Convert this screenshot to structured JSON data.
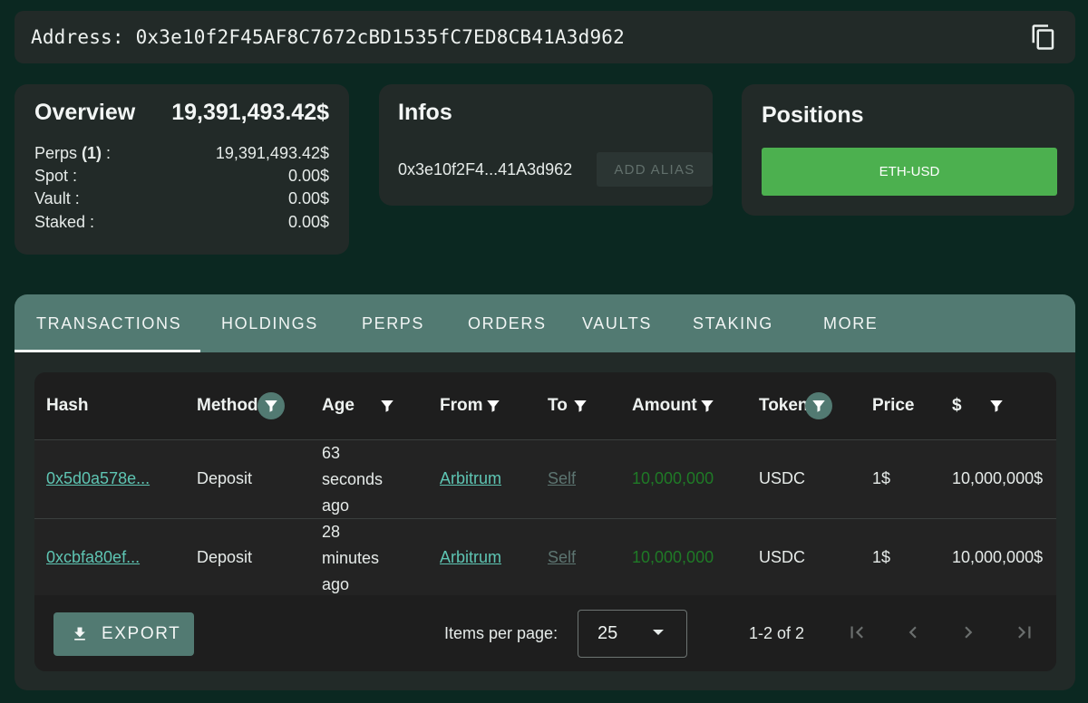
{
  "address_bar": {
    "label": "Address: 0x3e10f2F45AF8C7672cBD1535fC7ED8CB41A3d962",
    "copy_icon": "copy-icon"
  },
  "overview": {
    "title": "Overview",
    "total": "19,391,493.42$",
    "rows": [
      {
        "label": "Perps ",
        "count": "(1)",
        "suffix": " :",
        "value": "19,391,493.42$"
      },
      {
        "label": "Spot :",
        "value": "0.00$"
      },
      {
        "label": "Vault :",
        "value": "0.00$"
      },
      {
        "label": "Staked :",
        "value": "0.00$"
      }
    ]
  },
  "infos": {
    "title": "Infos",
    "address_short": "0x3e10f2F4...41A3d962",
    "add_alias_label": "ADD ALIAS"
  },
  "positions": {
    "title": "Positions",
    "items": [
      "ETH-USD"
    ]
  },
  "tabs": [
    {
      "label": "TRANSACTIONS",
      "active": true
    },
    {
      "label": "HOLDINGS"
    },
    {
      "label": "PERPS"
    },
    {
      "label": "ORDERS"
    },
    {
      "label": "VAULTS"
    },
    {
      "label": "STAKING"
    },
    {
      "label": "MORE"
    }
  ],
  "table": {
    "columns": [
      {
        "label": "Hash"
      },
      {
        "label": "Method",
        "filter": true,
        "filter_active": true
      },
      {
        "label": "Age",
        "filter": true
      },
      {
        "label": "From",
        "filter": true
      },
      {
        "label": "To",
        "filter": true
      },
      {
        "label": "Amount",
        "filter": true
      },
      {
        "label": "Token",
        "filter": true,
        "filter_active": true
      },
      {
        "label": "Price"
      },
      {
        "label": "$",
        "filter": true
      }
    ],
    "rows": [
      {
        "hash": "0x5d0a578e...",
        "method": "Deposit",
        "age": [
          "63",
          "seconds",
          "ago"
        ],
        "from": "Arbitrum",
        "to": "Self",
        "amount": "10,000,000",
        "token": "USDC",
        "price": "1$",
        "usd": "10,000,000$"
      },
      {
        "hash": "0xcbfa80ef...",
        "method": "Deposit",
        "age": [
          "28",
          "minutes",
          "ago"
        ],
        "from": "Arbitrum",
        "to": "Self",
        "amount": "10,000,000",
        "token": "USDC",
        "price": "1$",
        "usd": "10,000,000$"
      }
    ]
  },
  "footer": {
    "export_label": "EXPORT",
    "items_per_page_label": "Items per page:",
    "items_per_page_value": "25",
    "range": "1-2 of 2"
  },
  "colors": {
    "background": "#0b2821",
    "card": "#222a28",
    "accent": "#527a72",
    "positive": "#4cb04f",
    "link": "#5ec5b3"
  }
}
